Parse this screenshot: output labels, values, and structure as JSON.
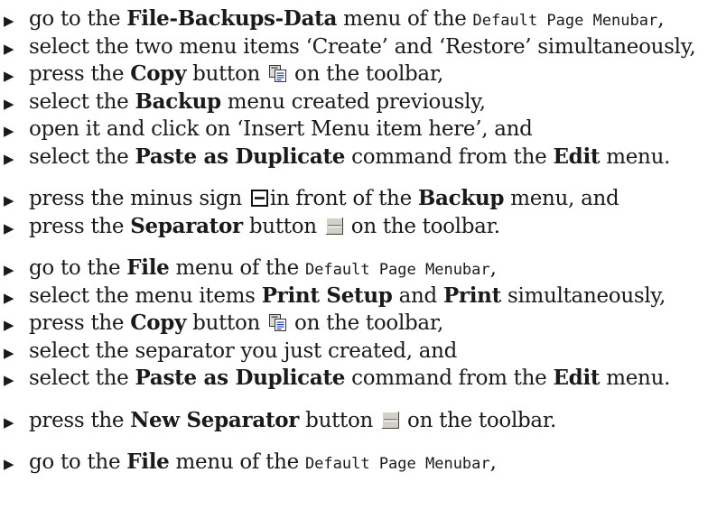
{
  "bullet_glyph": "▶",
  "groups": [
    {
      "steps": [
        {
          "parts": [
            {
              "t": "go to the "
            },
            {
              "t": "File-Backups-Data",
              "s": "b"
            },
            {
              "t": " menu of the "
            },
            {
              "t": "Default Page Menubar",
              "s": "mono"
            },
            {
              "t": ","
            }
          ]
        },
        {
          "parts": [
            {
              "t": "select the two menu items ‘Create’ and ‘Restore’ simultaneously,"
            }
          ]
        },
        {
          "parts": [
            {
              "t": "press the "
            },
            {
              "t": "Copy",
              "s": "b"
            },
            {
              "t": " button "
            },
            {
              "icon": "copy-icon"
            },
            {
              "t": " on the toolbar,"
            }
          ]
        },
        {
          "parts": [
            {
              "t": "select the "
            },
            {
              "t": "Backup",
              "s": "b"
            },
            {
              "t": " menu created previously,"
            }
          ]
        },
        {
          "parts": [
            {
              "t": "open it and click on ‘Insert Menu item here’, and"
            }
          ]
        },
        {
          "parts": [
            {
              "t": "select the "
            },
            {
              "t": "Paste as Duplicate",
              "s": "b"
            },
            {
              "t": " command from the "
            },
            {
              "t": "Edit",
              "s": "b"
            },
            {
              "t": " menu."
            }
          ]
        }
      ]
    },
    {
      "steps": [
        {
          "parts": [
            {
              "t": "press the minus sign "
            },
            {
              "icon": "minus-box-icon"
            },
            {
              "t": "in front of the "
            },
            {
              "t": "Backup",
              "s": "b"
            },
            {
              "t": " menu, and"
            }
          ]
        },
        {
          "parts": [
            {
              "t": "press the "
            },
            {
              "t": "Separator",
              "s": "b"
            },
            {
              "t": " button "
            },
            {
              "icon": "separator-icon"
            },
            {
              "t": " on the toolbar."
            }
          ]
        }
      ]
    },
    {
      "steps": [
        {
          "parts": [
            {
              "t": "go to the "
            },
            {
              "t": "File",
              "s": "b"
            },
            {
              "t": " menu of the "
            },
            {
              "t": "Default Page Menubar",
              "s": "mono"
            },
            {
              "t": ","
            }
          ]
        },
        {
          "parts": [
            {
              "t": "select the menu items "
            },
            {
              "t": "Print Setup",
              "s": "b"
            },
            {
              "t": " and "
            },
            {
              "t": "Print",
              "s": "b"
            },
            {
              "t": " simultaneously,"
            }
          ]
        },
        {
          "parts": [
            {
              "t": "press the "
            },
            {
              "t": "Copy",
              "s": "b"
            },
            {
              "t": " button "
            },
            {
              "icon": "copy-icon"
            },
            {
              "t": " on the toolbar,"
            }
          ]
        },
        {
          "parts": [
            {
              "t": "select the separator you just created, and"
            }
          ]
        },
        {
          "parts": [
            {
              "t": "select the "
            },
            {
              "t": "Paste as Duplicate",
              "s": "b"
            },
            {
              "t": " command from the "
            },
            {
              "t": "Edit",
              "s": "b"
            },
            {
              "t": " menu."
            }
          ]
        }
      ]
    },
    {
      "steps": [
        {
          "parts": [
            {
              "t": "press the "
            },
            {
              "t": "New Separator",
              "s": "b"
            },
            {
              "t": " button "
            },
            {
              "icon": "separator-icon"
            },
            {
              "t": " on the toolbar."
            }
          ]
        }
      ]
    },
    {
      "steps": [
        {
          "parts": [
            {
              "t": "go to the "
            },
            {
              "t": "File",
              "s": "b"
            },
            {
              "t": " menu of the "
            },
            {
              "t": "Default Page Menubar",
              "s": "mono"
            },
            {
              "t": ","
            }
          ]
        }
      ]
    }
  ]
}
